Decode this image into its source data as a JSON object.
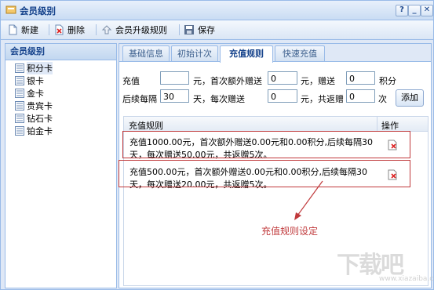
{
  "window": {
    "title": "会员级别",
    "controls": [
      "?",
      "_",
      "✕"
    ]
  },
  "toolbar": {
    "new_label": "新建",
    "delete_label": "删除",
    "upgrade_label": "会员升级规则",
    "save_label": "保存"
  },
  "sidebar": {
    "header": "会员级别",
    "items": [
      {
        "label": "积分卡"
      },
      {
        "label": "银卡"
      },
      {
        "label": "金卡"
      },
      {
        "label": "贵宾卡"
      },
      {
        "label": "钻石卡"
      },
      {
        "label": "铂金卡"
      }
    ]
  },
  "tabs": [
    {
      "label": "基础信息"
    },
    {
      "label": "初始计次"
    },
    {
      "label": "充值规则"
    },
    {
      "label": "快速充值"
    }
  ],
  "form": {
    "recharge_label": "充值",
    "yuan1": "元，首次额外赠送",
    "value_recharge": "",
    "value_first_extra": "0",
    "yuan_gift": "元，赠送",
    "value_gift_points": "0",
    "points_label": "积分",
    "after_every_label": "后续每隔",
    "value_interval": "30",
    "days_each_gift": "天，每次赠送",
    "value_each_gift": "0",
    "yuan_total": "元，共返赠",
    "value_times": "0",
    "times_label": "次",
    "add_label": "添加"
  },
  "grid": {
    "col_rule": "充值规则",
    "col_action": "操作",
    "rows": [
      {
        "line1": "充值1000.00元，首次额外赠送0.00元和0.00积分,后续每隔30",
        "line2": "天，每次赠送50.00元，共返赠5次。"
      },
      {
        "line1": "充值500.00元，首次额外赠送0.00元和0.00积分,后续每隔30",
        "line2": "天，每次赠送20.00元，共返赠5次。"
      }
    ]
  },
  "annotation": "充值规则设定",
  "watermark": {
    "logo": "下载吧",
    "url": "www.xiazaiba.com"
  },
  "colors": {
    "accent": "#15428b",
    "border": "#99bbe8",
    "annotation": "#c0393b"
  }
}
